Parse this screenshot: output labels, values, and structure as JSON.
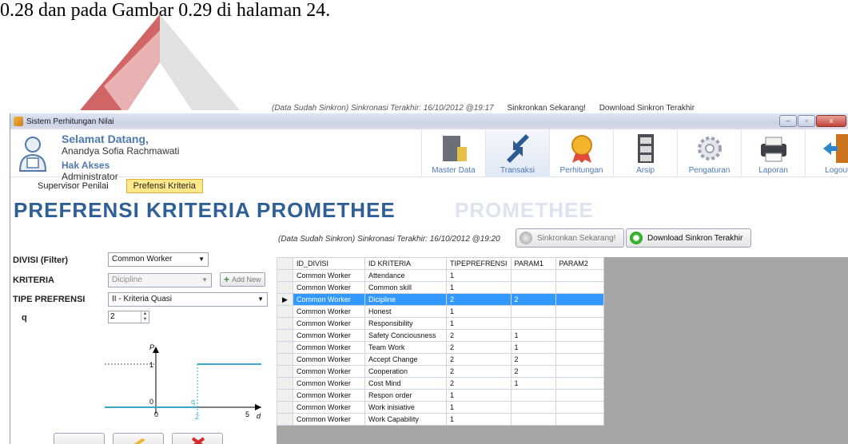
{
  "document": {
    "text": "0.28 dan pada Gambar 0.29 di halaman 24."
  },
  "ghost_header": {
    "sync_text": "(Data Sudah Sinkron) Sinkronasi  Terakhir: 16/10/2012 @19:17",
    "sync_button": "Sinkronkan Sekarang!",
    "download_button": "Download Sinkron Terakhir"
  },
  "window": {
    "title": "Sistem Perhitungan Nilai",
    "controls": [
      "–",
      "▫",
      "x"
    ]
  },
  "welcome": {
    "greeting": "Selamat Datang,",
    "name": "Anandya Sofia Rachmawati",
    "role_label": "Hak Akses",
    "role": "Administrator"
  },
  "toolbar": [
    {
      "label": "Master Data",
      "icon": "server-icon"
    },
    {
      "label": "Transaksi",
      "icon": "arrows-icon"
    },
    {
      "label": "Perhitungan",
      "icon": "medal-icon"
    },
    {
      "label": "Arsip",
      "icon": "cabinet-icon"
    },
    {
      "label": "Pengaturan",
      "icon": "gears-icon"
    },
    {
      "label": "Laporan",
      "icon": "printer-icon"
    },
    {
      "label": "Logout",
      "icon": "door-icon"
    }
  ],
  "tabs": [
    {
      "label": "Supervisor Penilai",
      "active": false
    },
    {
      "label": "Prefensi Kriteria",
      "active": true
    }
  ],
  "page": {
    "title": "PREFRENSI KRITERIA PROMETHEE",
    "sync_text": "(Data Sudah Sinkron) Sinkronasi  Terakhir: 16/10/2012 @19:20",
    "sync_button": "Sinkronkan Sekarang!",
    "download_button": "Download Sinkron Terakhir"
  },
  "form": {
    "divisi_label": "DIVISI (Filter)",
    "divisi_value": "Common Worker",
    "kriteria_label": "KRITERIA",
    "kriteria_value": "Dicipline",
    "add_new": "Add New",
    "tipe_label": "TIPE PREFRENSI",
    "tipe_value": "II - Kriteria Quasi",
    "q_label": "q",
    "q_value": "2"
  },
  "graph": {
    "y_axis": "P",
    "x_axis": "d",
    "y_one": "1",
    "y_zero": "0",
    "x_zero": "0",
    "x_q": "2",
    "x_five": "5",
    "q_mark": "q"
  },
  "grid": {
    "columns": [
      "ID_DIVISI",
      "ID KRITERIA",
      "TIPEPREFRENSI",
      "PARAM1",
      "PARAM2"
    ],
    "selected_index": 2,
    "rows": [
      [
        "Common Worker",
        "Attendance",
        "1",
        "",
        ""
      ],
      [
        "Common Worker",
        "Common skill",
        "1",
        "",
        ""
      ],
      [
        "Common Worker",
        "Dicipline",
        "2",
        "2",
        ""
      ],
      [
        "Common Worker",
        "Honest",
        "1",
        "",
        ""
      ],
      [
        "Common Worker",
        "Responsibility",
        "1",
        "",
        ""
      ],
      [
        "Common Worker",
        "Safety Conciousness",
        "2",
        "1",
        ""
      ],
      [
        "Common Worker",
        "Team Work",
        "2",
        "1",
        ""
      ],
      [
        "Common Worker",
        "Accept Change",
        "2",
        "2",
        ""
      ],
      [
        "Common Worker",
        "Cooperation",
        "2",
        "2",
        ""
      ],
      [
        "Common Worker",
        "Cost Mind",
        "2",
        "1",
        ""
      ],
      [
        "Common Worker",
        "Respon order",
        "1",
        "",
        ""
      ],
      [
        "Common Worker",
        "Work inisiative",
        "1",
        "",
        ""
      ],
      [
        "Common Worker",
        "Work Capability",
        "1",
        "",
        ""
      ]
    ]
  }
}
